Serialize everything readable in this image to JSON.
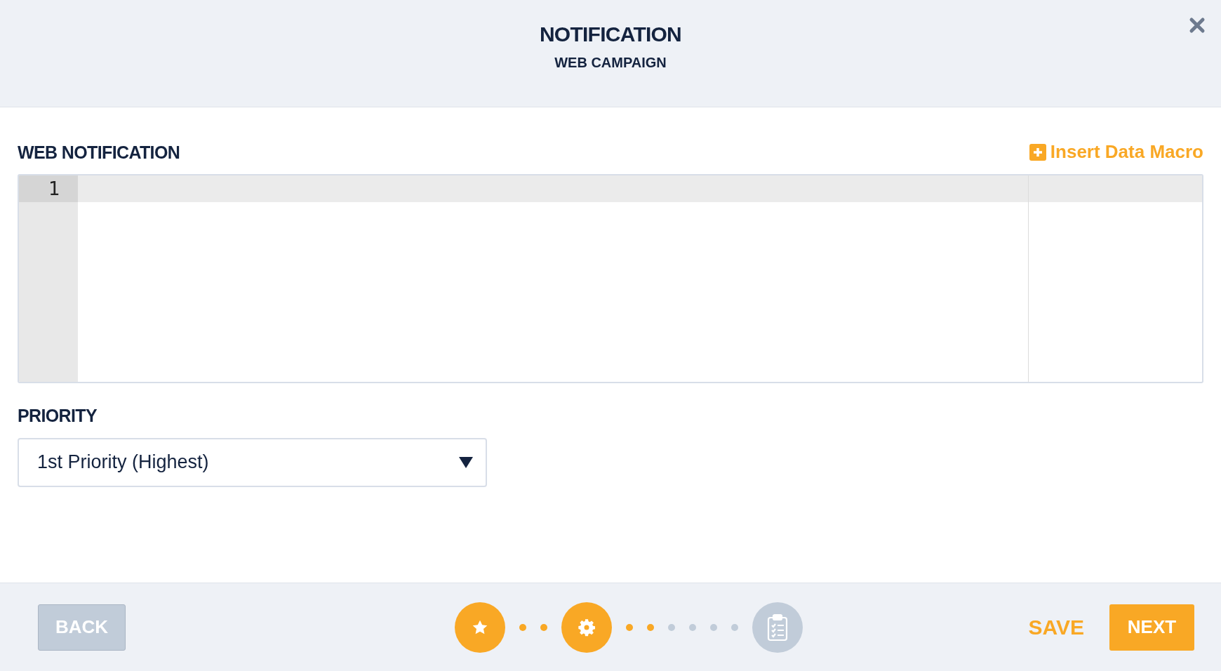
{
  "header": {
    "title": "NOTIFICATION",
    "subtitle": "WEB CAMPAIGN"
  },
  "editor": {
    "label": "WEB NOTIFICATION",
    "macro_link": "Insert Data Macro",
    "lines": [
      {
        "number": "1",
        "active": true
      }
    ]
  },
  "priority": {
    "label": "PRIORITY",
    "value": "1st Priority (Highest)"
  },
  "footer": {
    "back": "BACK",
    "back_disabled": true,
    "save": "SAVE",
    "next": "NEXT",
    "progress": [
      {
        "kind": "star",
        "completed": true
      },
      {
        "kind": "dot",
        "completed": true
      },
      {
        "kind": "dot",
        "completed": true
      },
      {
        "kind": "gear",
        "completed": true
      },
      {
        "kind": "dot",
        "completed": true
      },
      {
        "kind": "dot",
        "completed": true
      },
      {
        "kind": "dot",
        "completed": false
      },
      {
        "kind": "dot",
        "completed": false
      },
      {
        "kind": "dot",
        "completed": false
      },
      {
        "kind": "dot",
        "completed": false
      },
      {
        "kind": "clipboard",
        "completed": false
      }
    ]
  }
}
